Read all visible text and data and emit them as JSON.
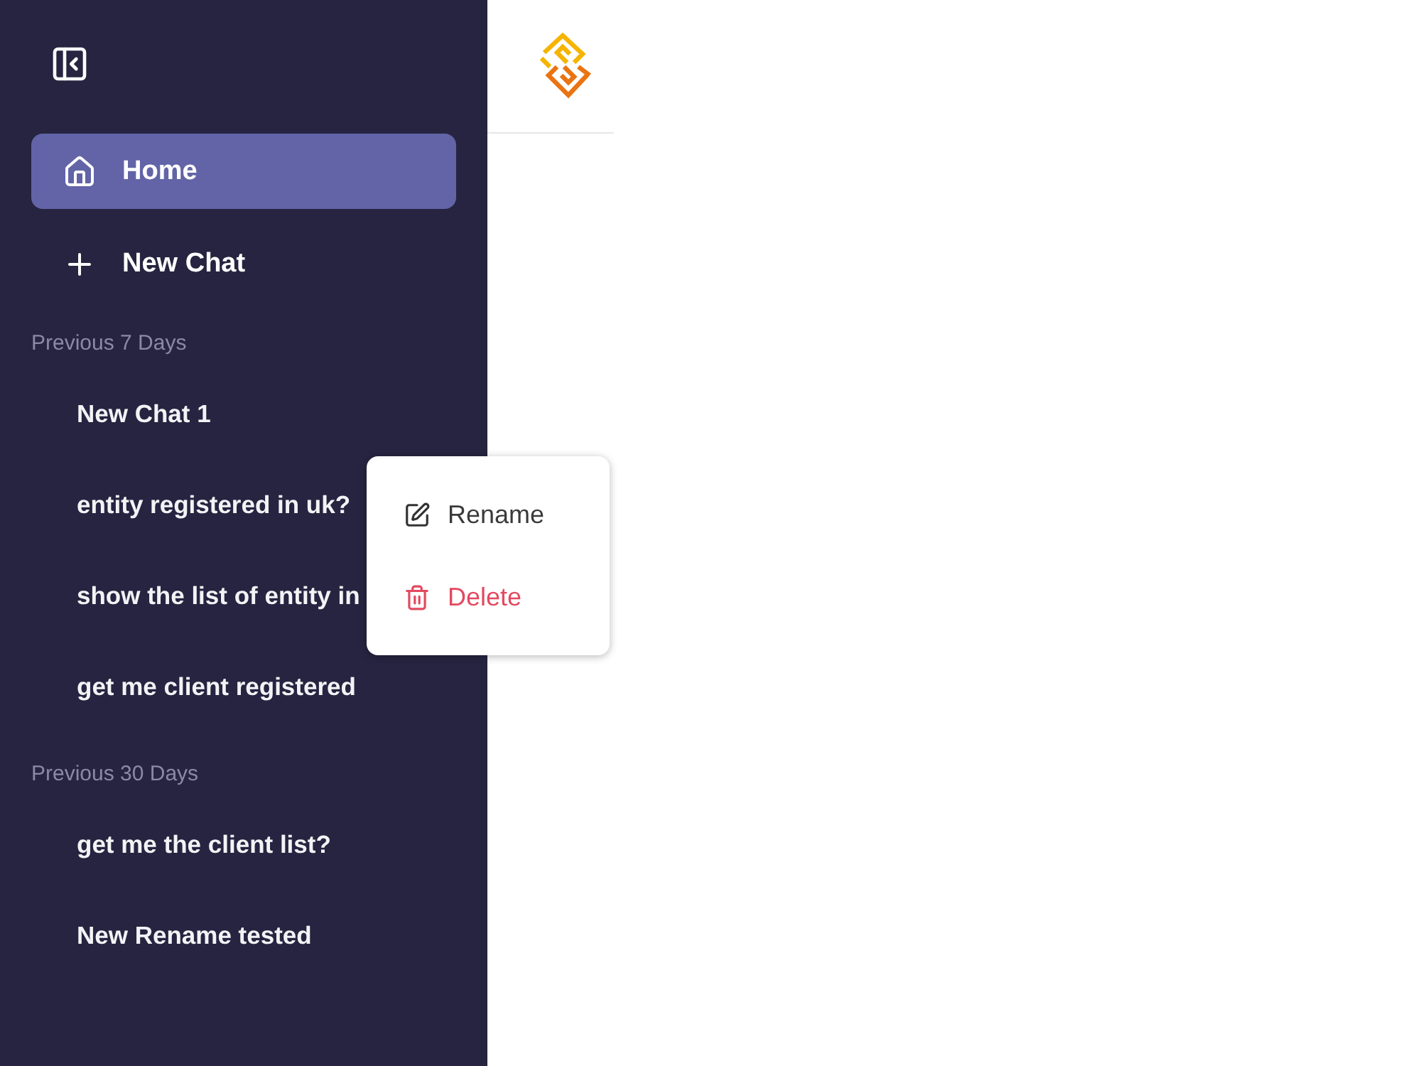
{
  "sidebar": {
    "nav": [
      {
        "label": "Home",
        "kind": "home",
        "selected": true
      },
      {
        "label": "New Chat",
        "kind": "create",
        "selected": false
      }
    ],
    "sections": [
      {
        "heading": "Previous 7 Days",
        "chats": [
          "New Chat 1",
          "entity registered in uk?",
          "show the list of entity in",
          "get me client registered"
        ]
      },
      {
        "heading": "Previous 30 Days",
        "chats": [
          "get me the client list?",
          "New Rename tested"
        ]
      }
    ]
  },
  "context_menu": {
    "items": [
      {
        "label": "Rename",
        "kind": "rename"
      },
      {
        "label": "Delete",
        "kind": "delete"
      }
    ]
  }
}
